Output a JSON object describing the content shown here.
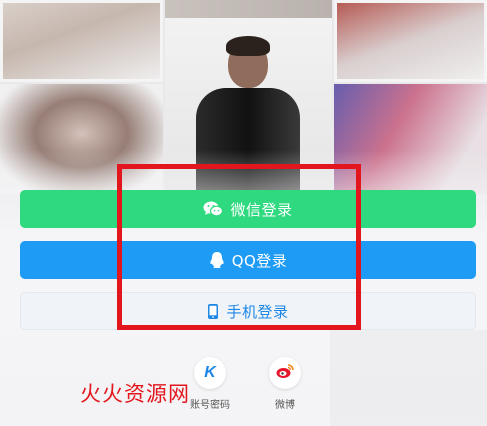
{
  "login": {
    "wechat_label": "微信登录",
    "qq_label": "QQ登录",
    "phone_label": "手机登录"
  },
  "alt_login": {
    "account_label": "账号密码",
    "account_icon_letter": "K",
    "weibo_label": "微博"
  },
  "watermark": "火火资源网",
  "colors": {
    "wechat": "#2fd97f",
    "qq": "#1d9bf5",
    "phone_text": "#1d87e6",
    "highlight": "#e3151d"
  },
  "icons": {
    "wechat": "wechat-icon",
    "qq": "qq-icon",
    "phone": "phone-icon",
    "account": "k-account-icon",
    "weibo": "weibo-icon"
  }
}
